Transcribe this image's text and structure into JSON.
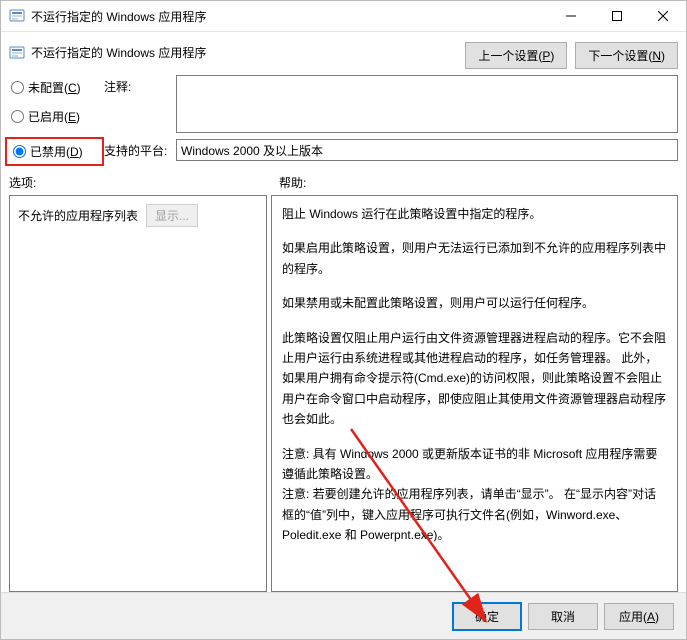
{
  "window": {
    "title": "不运行指定的 Windows 应用程序"
  },
  "header": {
    "title": "不运行指定的 Windows 应用程序",
    "prev_btn": "上一个设置(P)",
    "next_btn": "下一个设置(N)"
  },
  "radios": {
    "not_configured": "未配置(C)",
    "enabled": "已启用(E)",
    "disabled": "已禁用(D)"
  },
  "fields": {
    "comment_label": "注释:",
    "comment_value": "",
    "platform_label": "支持的平台:",
    "platform_value": "Windows 2000 及以上版本"
  },
  "labels": {
    "options": "选项:",
    "help": "帮助:"
  },
  "options": {
    "list_label": "不允许的应用程序列表",
    "show_btn": "显示..."
  },
  "help": {
    "p1": "阻止 Windows 运行在此策略设置中指定的程序。",
    "p2": "如果启用此策略设置，则用户无法运行已添加到不允许的应用程序列表中的程序。",
    "p3": "如果禁用或未配置此策略设置，则用户可以运行任何程序。",
    "p4": "此策略设置仅阻止用户运行由文件资源管理器进程启动的程序。它不会阻止用户运行由系统进程或其他进程启动的程序，如任务管理器。 此外，如果用户拥有命令提示符(Cmd.exe)的访问权限，则此策略设置不会阻止用户在命令窗口中启动程序，即使应阻止其使用文件资源管理器启动程序也会如此。",
    "p5a": "注意: 具有 Windows 2000 或更新版本证书的非 Microsoft 应用程序需要遵循此策略设置。",
    "p5b": "注意: 若要创建允许的应用程序列表，请单击“显示”。 在“显示内容”对话框的“值”列中，键入应用程序可执行文件名(例如，Winword.exe、Poledit.exe 和 Powerpnt.exe)。"
  },
  "footer": {
    "ok": "确定",
    "cancel": "取消",
    "apply": "应用(A)"
  }
}
